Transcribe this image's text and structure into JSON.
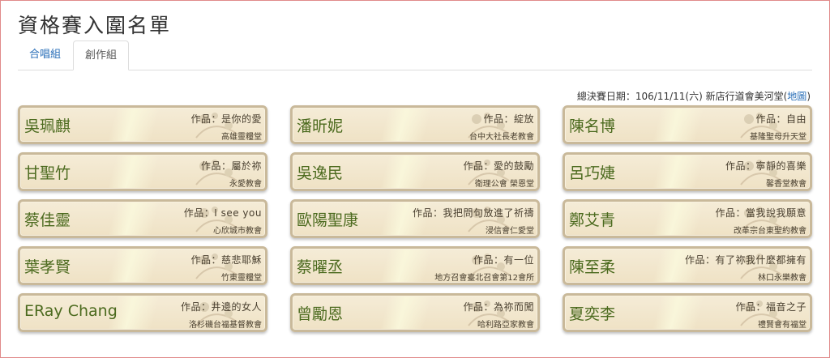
{
  "page": {
    "title": "資格賽入圍名單"
  },
  "tabs": [
    {
      "label": "合唱組"
    },
    {
      "label": "創作組"
    }
  ],
  "final_info": {
    "text": "總決賽日期：106/11/11(六) 新店行道會美河堂(",
    "map_label": "地圖",
    "close": ")"
  },
  "entries": [
    {
      "name": "吳珮麒",
      "work": "作品：是你的愛",
      "church": "高雄靈糧堂"
    },
    {
      "name": "潘昕妮",
      "work": "作品：綻放",
      "church": "台中大社長老教會"
    },
    {
      "name": "陳名博",
      "work": "作品：自由",
      "church": "基隆聖母升天堂"
    },
    {
      "name": "甘聖竹",
      "work": "作品：屬於祢",
      "church": "永愛教會"
    },
    {
      "name": "吳逸民",
      "work": "作品：愛的鼓勵",
      "church": "衛理公會 榮恩堂"
    },
    {
      "name": "呂巧婕",
      "work": "作品：寧靜的喜樂",
      "church": "馨香堂教會"
    },
    {
      "name": "蔡佳靈",
      "work": "作品：I see you",
      "church": "心欣城市教會"
    },
    {
      "name": "歐陽聖康",
      "work": "作品：我把問句放進了祈禱",
      "church": "浸信會仁愛堂"
    },
    {
      "name": "鄭艾青",
      "work": "作品：當我說我願意",
      "church": "改革宗台東聖約教會"
    },
    {
      "name": "葉孝賢",
      "work": "作品：慈悲耶穌",
      "church": "竹東靈糧堂"
    },
    {
      "name": "蔡曜丞",
      "work": "作品：有一位",
      "church": "地方召會臺北召會第12會所"
    },
    {
      "name": "陳至柔",
      "work": "作品：有了祢我什麼都擁有",
      "church": "林口永樂教會"
    },
    {
      "name": "ERay Chang",
      "work": "作品：井邊的女人",
      "church": "洛杉磯台福基督教會"
    },
    {
      "name": "曾勵恩",
      "work": "作品：為祢而闖",
      "church": "哈利路亞家教會"
    },
    {
      "name": "夏奕李",
      "work": "作品：福音之子",
      "church": "禮賢會有福堂"
    }
  ]
}
